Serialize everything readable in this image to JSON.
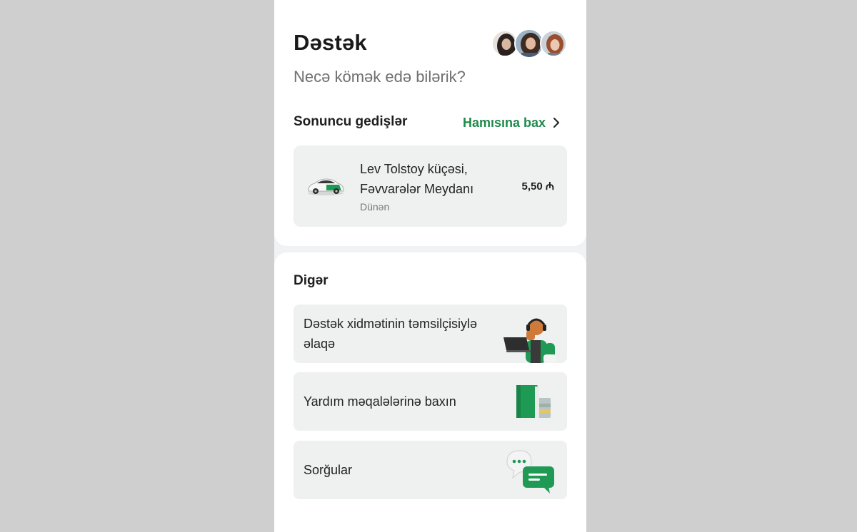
{
  "header": {
    "title": "Dəstək",
    "subtitle": "Necə kömək edə bilərik?"
  },
  "recent": {
    "section_title": "Sonuncu gedişlər",
    "see_all_label": "Hamısına bax",
    "ride": {
      "address": "Lev Tolstoy küçəsi, Fəvvarələr Meydanı",
      "date": "Dünən",
      "price": "5,50 ₼"
    }
  },
  "other": {
    "section_title": "Digər",
    "items": [
      {
        "label": "Dəstək xidmətinin təmsilçisiylə əlaqə",
        "icon": "support-agent-icon"
      },
      {
        "label": "Yardım məqalələrinə baxın",
        "icon": "book-icon"
      },
      {
        "label": "Sorğular",
        "icon": "chat-bubbles-icon"
      }
    ]
  },
  "colors": {
    "accent": "#1f8a4c",
    "card_bg": "#eff0f0",
    "page_bg": "#cfcfcf"
  }
}
